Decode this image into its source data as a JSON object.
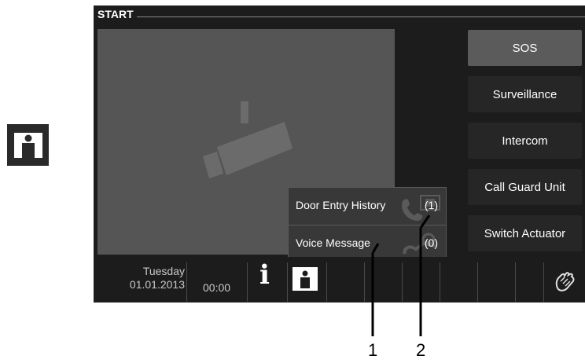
{
  "screen": {
    "title": "START",
    "menu_buttons": [
      {
        "label": "SOS",
        "active": true
      },
      {
        "label": "Surveillance",
        "active": false
      },
      {
        "label": "Intercom",
        "active": false
      },
      {
        "label": "Call Guard Unit",
        "active": false
      },
      {
        "label": "Switch Actuator",
        "active": false
      }
    ],
    "popup": {
      "door_entry_label": "Door Entry History",
      "door_entry_count": "(1)",
      "voice_message_label": "Voice Message",
      "voice_message_count": "(0)"
    },
    "status_bar": {
      "day": "Tuesday",
      "date": "01.01.2013",
      "time": "00:00",
      "info_icon": "info-icon",
      "user_icon": "user-icon",
      "hand_icon": "touch-hand-icon"
    },
    "camera_icon": "camera-icon"
  },
  "standalone_icon": "user-icon",
  "callouts": {
    "label_1": "1",
    "label_2": "2"
  },
  "colors": {
    "screen_background": "#1c1c1c",
    "camera_view": "#555555",
    "button": "#262626",
    "button_active": "#5b5b5b",
    "popup": "#383838"
  }
}
